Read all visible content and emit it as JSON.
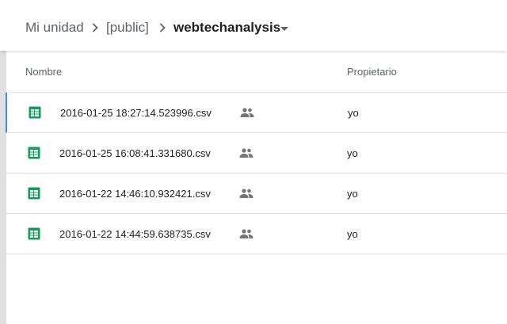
{
  "breadcrumb": {
    "items": [
      "Mi unidad",
      "[public]",
      "webtechanalysis"
    ]
  },
  "columns": {
    "name": "Nombre",
    "owner": "Propietario"
  },
  "files": [
    {
      "name": "2016-01-25 18:27:14.523996.csv",
      "owner": "yo",
      "icon": "sheets-icon",
      "shared": true,
      "selected": true
    },
    {
      "name": "2016-01-25 16:08:41.331680.csv",
      "owner": "yo",
      "icon": "sheets-icon",
      "shared": true,
      "selected": false
    },
    {
      "name": "2016-01-22 14:46:10.932421.csv",
      "owner": "yo",
      "icon": "sheets-icon",
      "shared": true,
      "selected": false
    },
    {
      "name": "2016-01-22 14:44:59.638735.csv",
      "owner": "yo",
      "icon": "sheets-icon",
      "shared": true,
      "selected": false
    }
  ],
  "colors": {
    "sheets_green": "#0f9d58",
    "selection_blue": "#4285f4",
    "icon_gray": "#757575"
  }
}
